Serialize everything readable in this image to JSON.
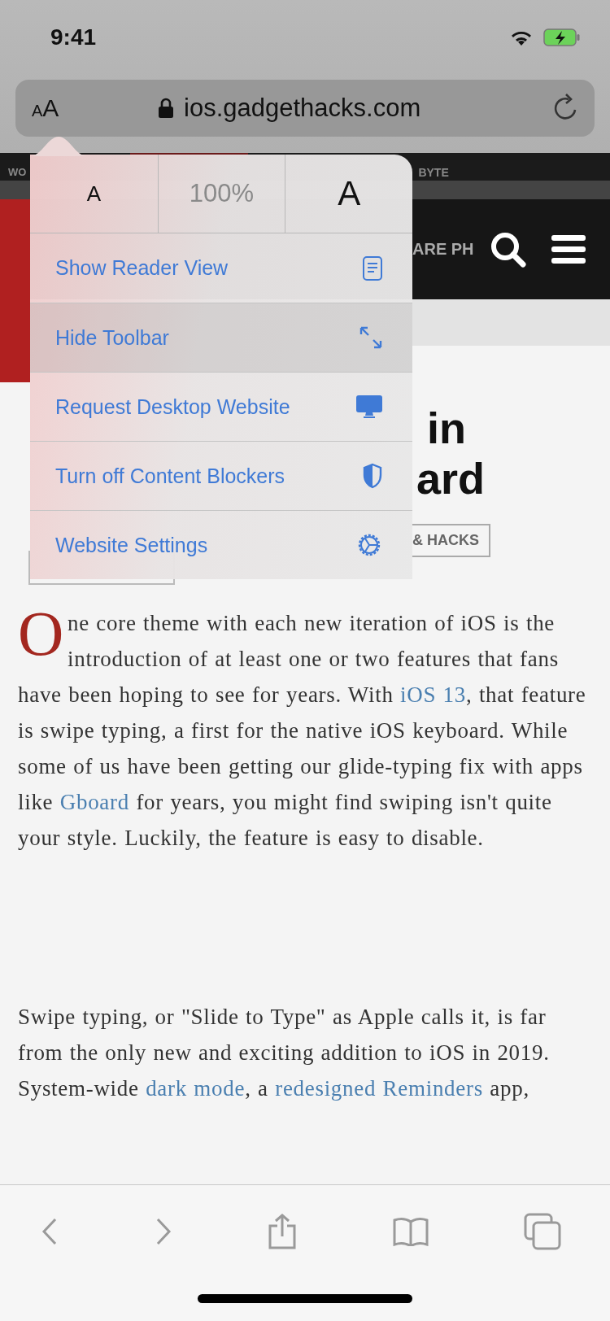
{
  "status_bar": {
    "time": "9:41"
  },
  "address_bar": {
    "text_size_button": {
      "small": "A",
      "large": "A"
    },
    "url": "ios.gadgethacks.com"
  },
  "page_behind": {
    "nav_left": "WO",
    "nav_right": "BYTE",
    "header_text": "ARE PH",
    "heading_line_1": {
      "right": "in"
    },
    "heading_line_2": {
      "right": "ard"
    },
    "tag": "& HACKS"
  },
  "article": {
    "drop_cap": "O",
    "paragraphs": [
      [
        {
          "text": "ne core theme with each new iteration of iOS is the introduction of at least one or two features that fans have been hoping to see for years. With ",
          "link": false
        },
        {
          "text": "iOS 13",
          "link": true
        },
        {
          "text": ", that feature is swipe typing, a first for the native iOS keyboard. While some of us have been getting our glide-typing fix with apps like ",
          "link": false
        },
        {
          "text": "Gboard",
          "link": true
        },
        {
          "text": " for years, you might find swiping isn't quite your style. Luckily, the feature is easy to disable.",
          "link": false
        }
      ],
      [
        {
          "text": "Swipe typing, or \"Slide to Type\" as Apple calls it, is far from the only new and exciting addition to iOS in 2019. System-wide ",
          "link": false
        },
        {
          "text": "dark mode",
          "link": true
        },
        {
          "text": ", a ",
          "link": false
        },
        {
          "text": "redesigned Reminders",
          "link": true
        },
        {
          "text": " app,",
          "link": false
        }
      ]
    ]
  },
  "popover": {
    "zoom": {
      "smaller": "A",
      "percent": "100%",
      "larger": "A"
    },
    "items": [
      {
        "label": "Show Reader View",
        "kind": "reader",
        "selected": false
      },
      {
        "label": "Hide Toolbar",
        "kind": "expand",
        "selected": true
      },
      {
        "label": "Request Desktop Website",
        "kind": "desktop",
        "selected": false
      },
      {
        "label": "Turn off Content Blockers",
        "kind": "shield",
        "selected": false
      },
      {
        "label": "Website Settings",
        "kind": "gear",
        "selected": false
      }
    ]
  }
}
